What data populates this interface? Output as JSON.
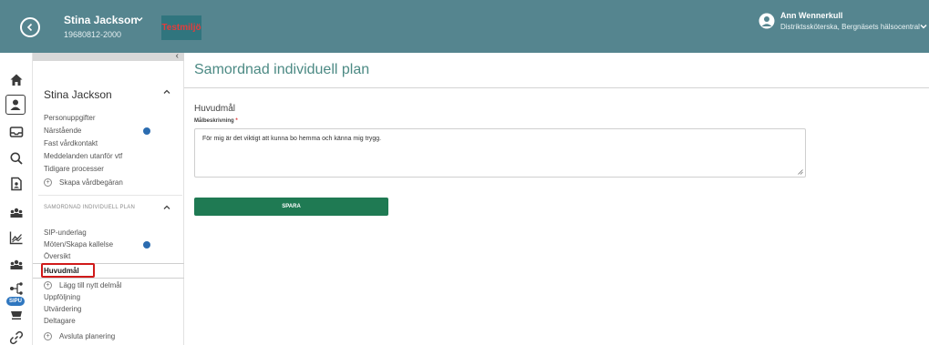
{
  "header": {
    "patient_name": "Stina Jackson",
    "patient_id": "19680812-2000",
    "environment_badge": "Testmiljö",
    "user_name": "Ann Wennerkull",
    "user_role": "Distriktssköterska, Bergnäsets hälsocentral"
  },
  "nav": {
    "patient_heading": "Stina Jackson",
    "items": [
      {
        "label": "Personuppgifter"
      },
      {
        "label": "Närstående"
      },
      {
        "label": "Fast vårdkontakt"
      },
      {
        "label": "Meddelanden utanför vtf"
      },
      {
        "label": "Tidigare processer"
      }
    ],
    "create_request": "Skapa vårdbegäran",
    "section_title": "SAMORDNAD INDIVIDUELL PLAN",
    "sip_items": [
      {
        "label": "SIP-underlag"
      },
      {
        "label": "Möten/Skapa kallelse"
      },
      {
        "label": "Översikt"
      }
    ],
    "selected": "Huvudmål",
    "add_subgoal": "Lägg till nytt delmål",
    "after_items": [
      {
        "label": "Uppföljning"
      },
      {
        "label": "Utvärdering"
      },
      {
        "label": "Deltagare"
      }
    ],
    "end_planning": "Avsluta planering"
  },
  "rail": {
    "icons": [
      "home-icon",
      "patient-icon",
      "inbox-icon",
      "search-icon",
      "document-icon",
      "group-icon",
      "chart-icon",
      "group-icon-2",
      "network-icon",
      "sipu-icon",
      "link-icon"
    ],
    "sipu_label": "SIPU"
  },
  "main": {
    "page_title": "Samordnad individuell plan",
    "section_label": "Huvudmål",
    "field_label": "Målbeskrivning",
    "required_marker": "*",
    "goal_text": "För mig är det viktigt att kunna bo hemma och känna mig trygg.",
    "save_label": "SPARA"
  },
  "colors": {
    "header_bg": "#55858f",
    "title_green": "#4c8a84",
    "save_green": "#1f7a53",
    "badge_red": "#e43c3c",
    "selected_outline": "#d01a1a",
    "dot_blue": "#2b6cb0"
  }
}
